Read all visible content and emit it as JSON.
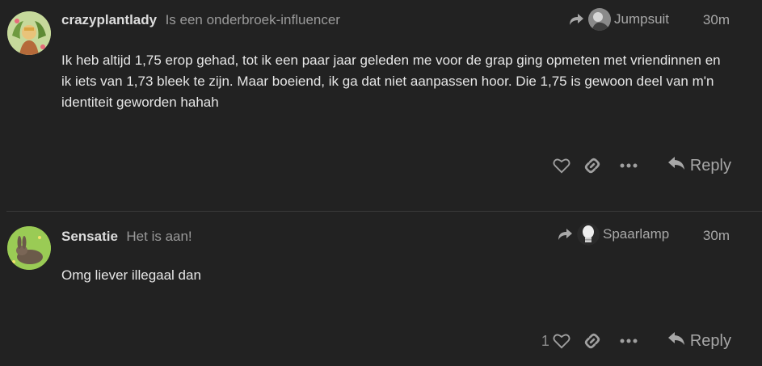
{
  "posts": [
    {
      "username": "crazyplantlady",
      "user_title": "Is een onderbroek-influencer",
      "reply_to_user": "Jumpsuit",
      "age": "30m",
      "body": "Ik heb altijd 1,75 erop gehad, tot ik een paar jaar geleden me voor de grap ging opmeten met vriendinnen en ik iets van 1,73 bleek te zijn. Maar boeiend, ik ga dat niet aanpassen hoor. Die 1,75 is gewoon deel van m'n identiteit geworden hahah",
      "like_count": "",
      "reply_label": "Reply"
    },
    {
      "username": "Sensatie",
      "user_title": "Het is aan!",
      "reply_to_user": "Spaarlamp",
      "age": "30m",
      "body": "Omg liever illegaal dan",
      "like_count": "1",
      "reply_label": "Reply"
    }
  ],
  "icons": {
    "reply_to": "reply-arrow-icon",
    "like": "heart-icon",
    "link": "link-icon",
    "more": "ellipsis-icon",
    "reply": "reply-icon"
  },
  "colors": {
    "background": "#222222",
    "text": "#e6e6e6",
    "muted": "#a8a8a8"
  }
}
